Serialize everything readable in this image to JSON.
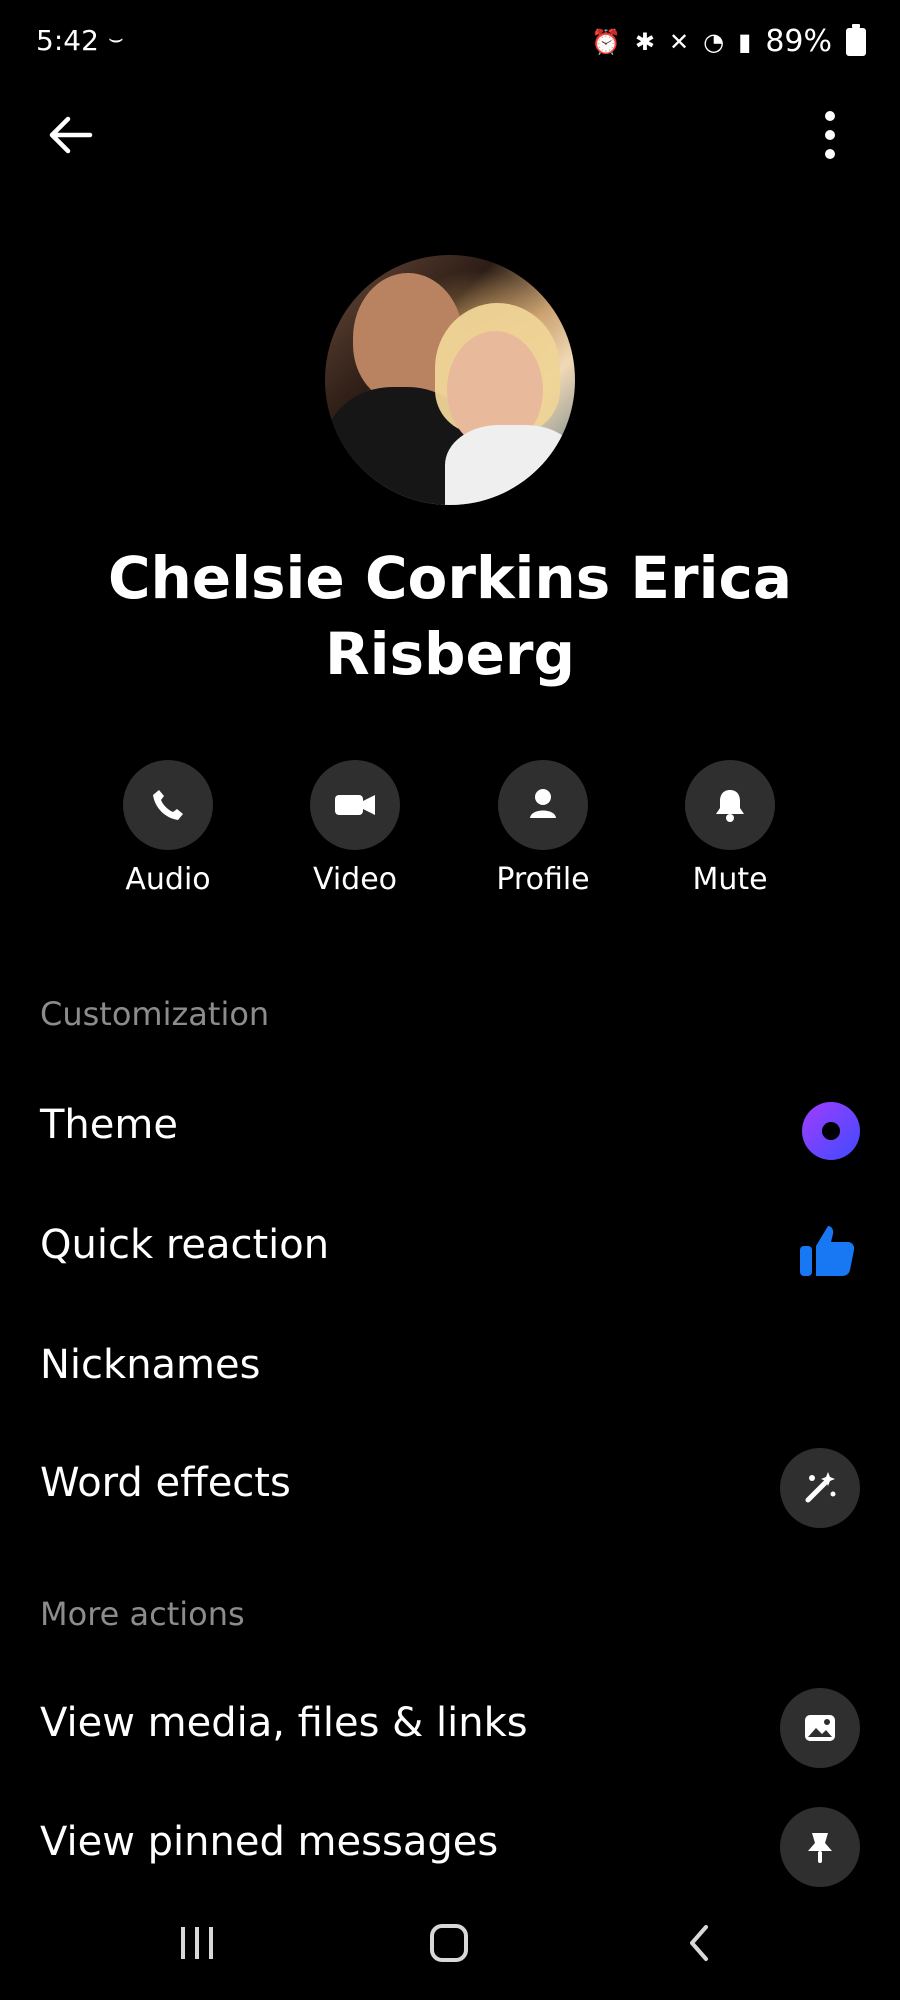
{
  "status_bar": {
    "time": "5:42",
    "battery_percent": "89%",
    "icons": [
      "amazon-icon",
      "alarm-icon",
      "bluetooth-icon",
      "mute-icon",
      "wifi-icon",
      "signal-icon",
      "battery-icon"
    ]
  },
  "header": {
    "back_icon": "arrow-left-icon",
    "menu_icon": "more-vertical-icon"
  },
  "profile": {
    "name": "Chelsie Corkins Erica Risberg"
  },
  "quick_actions": [
    {
      "label": "Audio",
      "icon": "phone-icon"
    },
    {
      "label": "Video",
      "icon": "video-camera-icon"
    },
    {
      "label": "Profile",
      "icon": "person-icon"
    },
    {
      "label": "Mute",
      "icon": "bell-icon"
    }
  ],
  "customization": {
    "title": "Customization",
    "rows": [
      {
        "label": "Theme",
        "icon": "theme-color-icon"
      },
      {
        "label": "Quick reaction",
        "icon": "thumbs-up-icon"
      },
      {
        "label": "Nicknames"
      },
      {
        "label": "Word effects",
        "icon": "magic-wand-icon"
      }
    ]
  },
  "more_actions": {
    "title": "More actions",
    "rows": [
      {
        "label": "View media, files & links",
        "icon": "image-icon"
      },
      {
        "label": "View pinned messages",
        "icon": "pin-icon"
      }
    ]
  },
  "colors": {
    "background": "#000000",
    "accent_blue": "#1877F2",
    "theme_gradient_start": "#A13DFF",
    "theme_gradient_end": "#3E4BFF",
    "circle_bg": "#2F2F2F",
    "section_title": "#8C8C8C"
  }
}
